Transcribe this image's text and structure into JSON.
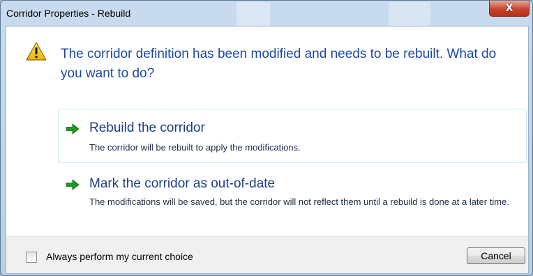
{
  "window": {
    "title": "Corridor Properties - Rebuild",
    "close_glyph": "X"
  },
  "main": {
    "icon": "warning-icon",
    "heading": "The corridor definition has been modified and needs to be rebuilt. What do you want to do?",
    "options": [
      {
        "title": "Rebuild the corridor",
        "description": "The corridor will be rebuilt to apply the modifications.",
        "icon": "green-arrow-icon",
        "selected": true
      },
      {
        "title": "Mark the corridor as out-of-date",
        "description": "The modifications will be saved, but the corridor will not reflect them until a rebuild is done at a later time.",
        "icon": "green-arrow-icon",
        "selected": false
      }
    ]
  },
  "footer": {
    "checkbox_label": "Always perform my current choice",
    "checkbox_checked": false,
    "cancel_label": "Cancel"
  },
  "colors": {
    "heading": "#1c49a6",
    "arrow": "#1f9a1f",
    "close": "#c7442d"
  }
}
